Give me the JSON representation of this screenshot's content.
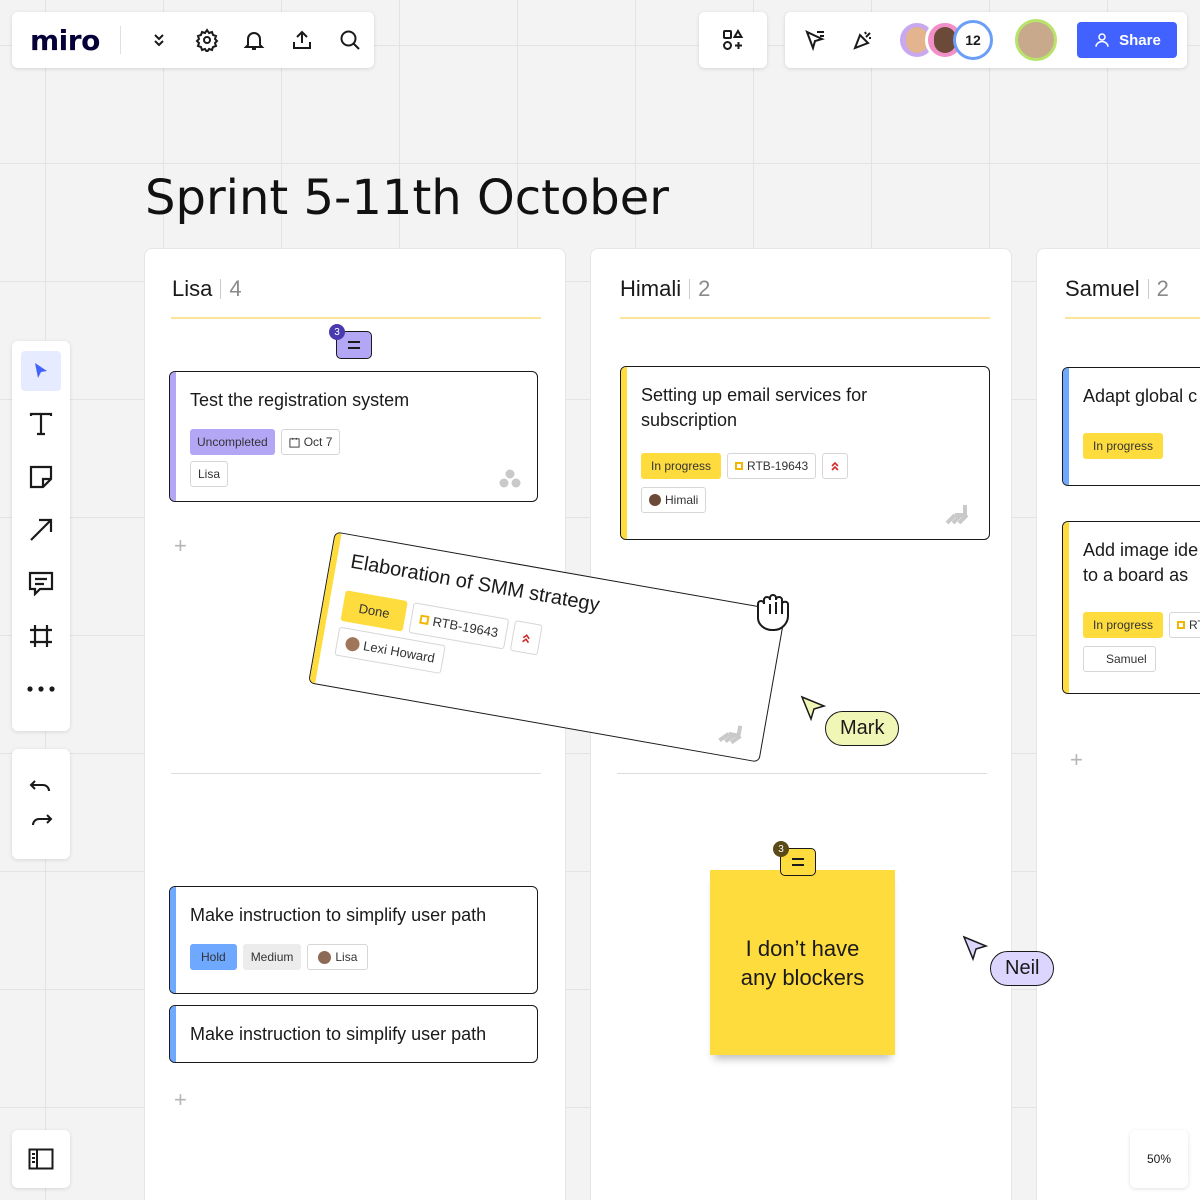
{
  "app": {
    "logo": "miro"
  },
  "header": {
    "collaborator_count": "12",
    "share_label": "Share"
  },
  "board": {
    "title": "Sprint 5-11th October"
  },
  "columns": [
    {
      "name": "Lisa",
      "count": "4"
    },
    {
      "name": "Himali",
      "count": "2"
    },
    {
      "name": "Samuel",
      "count": "2"
    }
  ],
  "cards": {
    "lisa_1": {
      "title": "Test the registration system",
      "status": "Uncompleted",
      "date": "Oct 7",
      "assignee": "Lisa",
      "comment_count": "3"
    },
    "lisa_2": {
      "title": "Make instruction to simplify user path",
      "status": "Hold",
      "priority": "Medium",
      "assignee": "Lisa"
    },
    "lisa_3": {
      "title": "Make instruction to simplify user path"
    },
    "dragged": {
      "title": "Elaboration of SMM strategy",
      "status": "Done",
      "ticket": "RTB-19643",
      "assignee": "Lexi Howard"
    },
    "himali_1": {
      "title": "Setting up email services for subscription",
      "status": "In progress",
      "ticket": "RTB-19643",
      "assignee": "Himali"
    },
    "samuel_1": {
      "title": "Adapt global c",
      "status": "In progress"
    },
    "samuel_2": {
      "title": "Add image ide to a board as s",
      "status": "In progress",
      "ticket": "RT",
      "assignee": "Samuel"
    }
  },
  "sticky": {
    "text": "I don’t have any blockers",
    "comment_count": "3"
  },
  "cursors": [
    {
      "name": "Mark",
      "color": "#f0f7b6"
    },
    {
      "name": "Neil",
      "color": "#dcd6ff"
    }
  ],
  "zoom": "50%",
  "colors": {
    "accent_blue": "#4262ff",
    "purple": "#8f7ee7",
    "yellow": "#ffdc3d",
    "blue_tag": "#6ea8ff"
  }
}
